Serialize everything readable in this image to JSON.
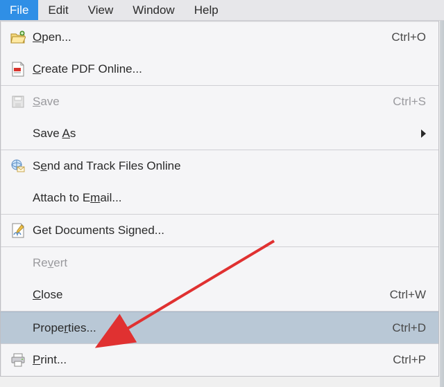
{
  "menubar": {
    "items": [
      {
        "label": "File",
        "active": true
      },
      {
        "label": "Edit"
      },
      {
        "label": "View"
      },
      {
        "label": "Window"
      },
      {
        "label": "Help"
      }
    ]
  },
  "dropdown": {
    "open": {
      "pre": "",
      "u": "O",
      "post": "pen...",
      "shortcut": "Ctrl+O"
    },
    "create_pdf_online": {
      "pre": "",
      "u": "C",
      "post": "reate PDF Online..."
    },
    "save": {
      "pre": "",
      "u": "S",
      "post": "ave",
      "shortcut": "Ctrl+S"
    },
    "save_as": {
      "pre": "Save ",
      "u": "A",
      "post": "s"
    },
    "send_track": {
      "pre": "S",
      "u": "e",
      "post": "nd and Track Files Online"
    },
    "attach_email": {
      "pre": "Attach to E",
      "u": "m",
      "post": "ail..."
    },
    "get_signed": {
      "pre": "Get Documents Si",
      "u": "g",
      "post": "ned..."
    },
    "revert": {
      "pre": "Re",
      "u": "v",
      "post": "ert"
    },
    "close": {
      "pre": "",
      "u": "C",
      "post": "lose",
      "shortcut": "Ctrl+W"
    },
    "properties": {
      "pre": "Prope",
      "u": "r",
      "post": "ties...",
      "shortcut": "Ctrl+D"
    },
    "print": {
      "pre": "",
      "u": "P",
      "post": "rint...",
      "shortcut": "Ctrl+P"
    }
  },
  "annotation": {
    "purpose": "arrow-to-properties",
    "color": "#e03131"
  }
}
